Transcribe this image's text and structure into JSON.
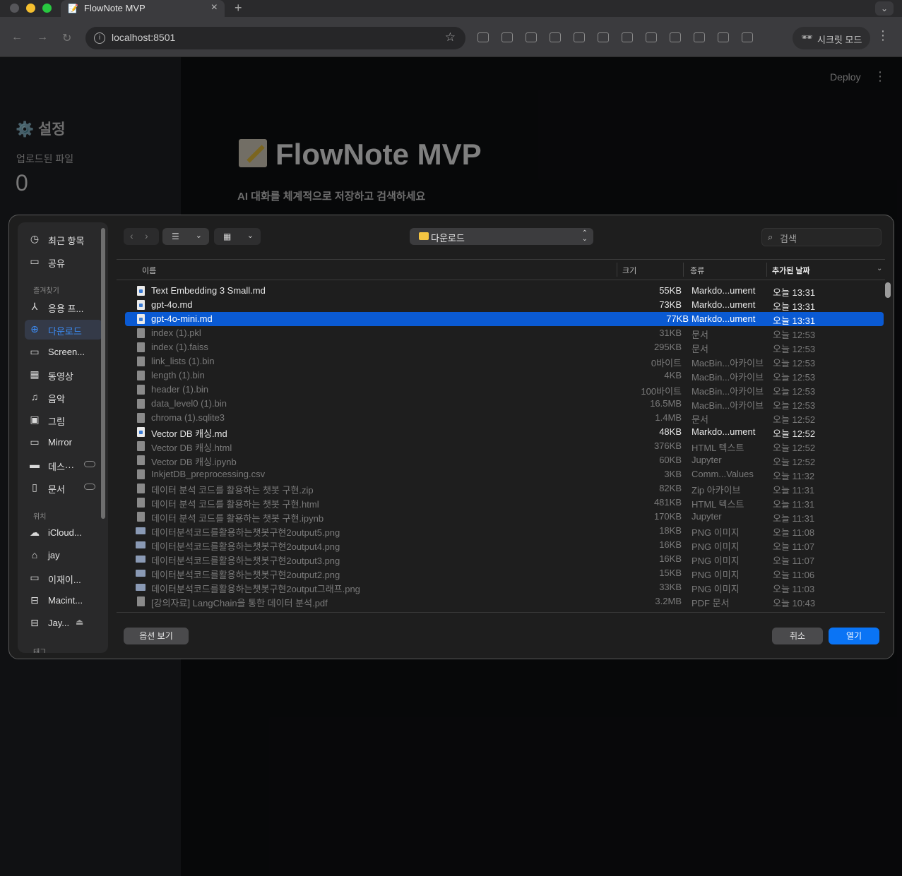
{
  "browser": {
    "tab_title": "FlowNote MVP",
    "tab_close": "×",
    "tab_new": "+",
    "tab_menu": "⌄",
    "url": "localhost:8501",
    "incognito_label": "시크릿 모드"
  },
  "app": {
    "deploy_label": "Deploy",
    "more": "⋮",
    "sidebar_title": "⚙️ 설정",
    "uploaded_label": "업로드된 파일",
    "uploaded_count": "0",
    "title": "FlowNote MVP",
    "subtitle": "AI 대화를 체계적으로 저장하고 검색하세요"
  },
  "dialog": {
    "location": "다운로드",
    "search_placeholder": "검색",
    "columns": {
      "name": "이름",
      "size": "크기",
      "kind": "종류",
      "date_added": "추가된 날짜"
    },
    "sidebar": {
      "recent": "최근 항목",
      "shared": "공유",
      "favorites_header": "즐겨찾기",
      "apps": "응용 프...",
      "downloads": "다운로드",
      "screenshots": "Screen...",
      "movies": "동영상",
      "music": "음악",
      "pictures": "그림",
      "mirror": "Mirror",
      "desktop": "데스···",
      "documents": "문서",
      "locations_header": "위치",
      "icloud": "iCloud...",
      "home": "jay",
      "mac": "이재이...",
      "macintosh": "Macint...",
      "jay_drive": "Jay...",
      "tags_header": "태그"
    },
    "files": [
      {
        "name": "Text Embedding 3 Small.md",
        "size": "55KB",
        "kind": "Markdo...ument",
        "date": "오늘 13:31",
        "icon": "md",
        "enabled": true,
        "selected": false
      },
      {
        "name": "gpt-4o.md",
        "size": "73KB",
        "kind": "Markdo...ument",
        "date": "오늘 13:31",
        "icon": "md",
        "enabled": true,
        "selected": false
      },
      {
        "name": "gpt-4o-mini.md",
        "size": "77KB",
        "kind": "Markdo...ument",
        "date": "오늘 13:31",
        "icon": "md",
        "enabled": true,
        "selected": true
      },
      {
        "name": "index (1).pkl",
        "size": "31KB",
        "kind": "문서",
        "date": "오늘 12:53",
        "icon": "doc",
        "enabled": false,
        "selected": false
      },
      {
        "name": "index (1).faiss",
        "size": "295KB",
        "kind": "문서",
        "date": "오늘 12:53",
        "icon": "doc",
        "enabled": false,
        "selected": false
      },
      {
        "name": "link_lists (1).bin",
        "size": "0바이트",
        "kind": "MacBin...아카이브",
        "date": "오늘 12:53",
        "icon": "doc",
        "enabled": false,
        "selected": false
      },
      {
        "name": "length (1).bin",
        "size": "4KB",
        "kind": "MacBin...아카이브",
        "date": "오늘 12:53",
        "icon": "doc",
        "enabled": false,
        "selected": false
      },
      {
        "name": "header (1).bin",
        "size": "100바이트",
        "kind": "MacBin...아카이브",
        "date": "오늘 12:53",
        "icon": "doc",
        "enabled": false,
        "selected": false
      },
      {
        "name": "data_level0 (1).bin",
        "size": "16.5MB",
        "kind": "MacBin...아카이브",
        "date": "오늘 12:53",
        "icon": "doc",
        "enabled": false,
        "selected": false
      },
      {
        "name": "chroma (1).sqlite3",
        "size": "1.4MB",
        "kind": "문서",
        "date": "오늘 12:52",
        "icon": "doc",
        "enabled": false,
        "selected": false
      },
      {
        "name": "Vector DB 캐싱.md",
        "size": "48KB",
        "kind": "Markdo...ument",
        "date": "오늘 12:52",
        "icon": "md",
        "enabled": true,
        "selected": false
      },
      {
        "name": "Vector DB 캐싱.html",
        "size": "376KB",
        "kind": "HTML 텍스트",
        "date": "오늘 12:52",
        "icon": "doc",
        "enabled": false,
        "selected": false
      },
      {
        "name": "Vector DB 캐싱.ipynb",
        "size": "60KB",
        "kind": "Jupyter",
        "date": "오늘 12:52",
        "icon": "doc",
        "enabled": false,
        "selected": false
      },
      {
        "name": "InkjetDB_preprocessing.csv",
        "size": "3KB",
        "kind": "Comm...Values",
        "date": "오늘 11:32",
        "icon": "doc",
        "enabled": false,
        "selected": false
      },
      {
        "name": "데이터 분석 코드를 활용하는 챗봇 구현.zip",
        "size": "82KB",
        "kind": "Zip 아카이브",
        "date": "오늘 11:31",
        "icon": "doc",
        "enabled": false,
        "selected": false
      },
      {
        "name": "데이터 분석 코드를 활용하는 챗봇 구현.html",
        "size": "481KB",
        "kind": "HTML 텍스트",
        "date": "오늘 11:31",
        "icon": "doc",
        "enabled": false,
        "selected": false
      },
      {
        "name": "데이터 분석 코드를 활용하는 챗봇 구현.ipynb",
        "size": "170KB",
        "kind": "Jupyter",
        "date": "오늘 11:31",
        "icon": "doc",
        "enabled": false,
        "selected": false
      },
      {
        "name": "데이터분석코드를활용하는챗봇구현2output5.png",
        "size": "18KB",
        "kind": "PNG 이미지",
        "date": "오늘 11:08",
        "icon": "img",
        "enabled": false,
        "selected": false
      },
      {
        "name": "데이터분석코드를활용하는챗봇구현2output4.png",
        "size": "16KB",
        "kind": "PNG 이미지",
        "date": "오늘 11:07",
        "icon": "img",
        "enabled": false,
        "selected": false
      },
      {
        "name": "데이터분석코드를활용하는챗봇구현2output3.png",
        "size": "16KB",
        "kind": "PNG 이미지",
        "date": "오늘 11:07",
        "icon": "img",
        "enabled": false,
        "selected": false
      },
      {
        "name": "데이터분석코드를활용하는챗봇구현2output2.png",
        "size": "15KB",
        "kind": "PNG 이미지",
        "date": "오늘 11:06",
        "icon": "img",
        "enabled": false,
        "selected": false
      },
      {
        "name": "데이터분석코드를활용하는챗봇구현2output그래프.png",
        "size": "33KB",
        "kind": "PNG 이미지",
        "date": "오늘 11:03",
        "icon": "img",
        "enabled": false,
        "selected": false
      },
      {
        "name": "[강의자료] LangChain을 통한 데이터 분석.pdf",
        "size": "3.2MB",
        "kind": "PDF 문서",
        "date": "오늘 10:43",
        "icon": "doc",
        "enabled": false,
        "selected": false
      }
    ],
    "buttons": {
      "options": "옵션 보기",
      "cancel": "취소",
      "open": "열기"
    }
  }
}
